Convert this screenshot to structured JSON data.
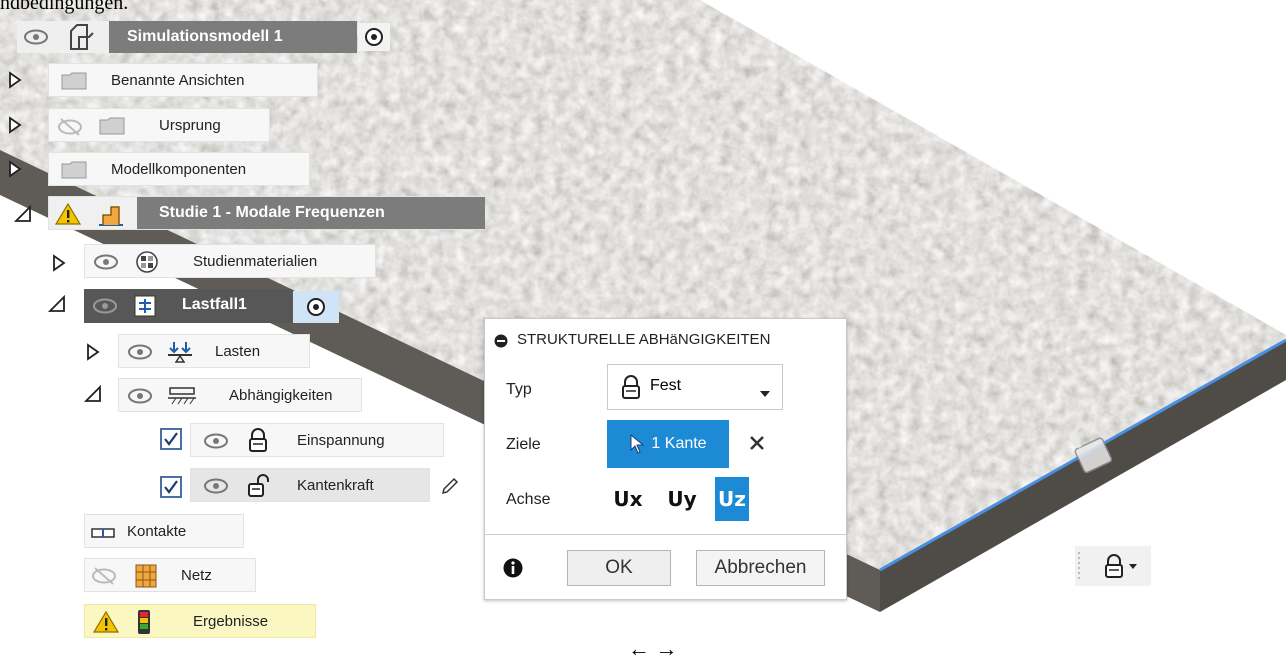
{
  "caption_top": "ndbedingungen.",
  "caption_bottom": "← →",
  "tree": {
    "root": "Simulationsmodell 1",
    "named_views": "Benannte Ansichten",
    "origin": "Ursprung",
    "components": "Modellkomponenten",
    "study": "Studie 1 - Modale Frequenzen",
    "materials": "Studienmaterialien",
    "loadcase": "Lastfall1",
    "loads": "Lasten",
    "constraints": "Abhängigkeiten",
    "fixed": "Einspannung",
    "edgeforce": "Kantenkraft",
    "contacts": "Kontakte",
    "mesh": "Netz",
    "results": "Ergebnisse"
  },
  "dialog": {
    "title": "STRUKTURELLE ABHäNGIGKEITEN",
    "type_label": "Typ",
    "type_value": "Fest",
    "targets_label": "Ziele",
    "targets_value": "1 Kante",
    "axis_label": "Achse",
    "axes": [
      "Ux",
      "Uy",
      "Uz"
    ],
    "selected_axis": "Uz",
    "ok": "OK",
    "cancel": "Abbrechen"
  },
  "colors": {
    "accent": "#1d8ad6",
    "warning": "#f5c400",
    "edge_highlight": "#4a90e2"
  }
}
